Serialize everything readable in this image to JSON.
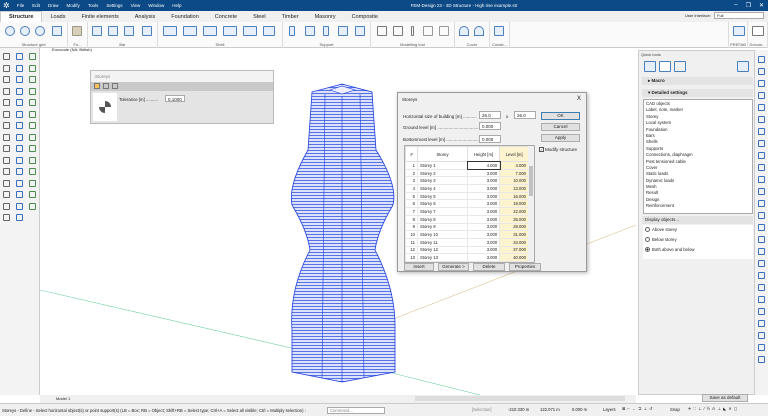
{
  "titlebar": {
    "title": "FEM-Design 23 - 3D Structure - High rise example.str",
    "menu": [
      "File",
      "Edit",
      "Draw",
      "Modify",
      "Tools",
      "Settings",
      "View",
      "Window",
      "Help"
    ]
  },
  "tabs": [
    "Structure",
    "Loads",
    "Finite elements",
    "Analysis",
    "Foundation",
    "Concrete",
    "Steel",
    "Timber",
    "Masonry",
    "Composite"
  ],
  "user_interface": {
    "label": "User interface:",
    "value": "Full"
  },
  "ribbon_groups": [
    "Structure grid",
    "Fo...",
    "Bar",
    "Shell",
    "Support",
    "Modelling tool",
    "Cover",
    "Constr...",
    "PREFAB",
    "Docum..."
  ],
  "canvas": {
    "code": "Eurocode (NA: British)",
    "model_tab": "Model 1"
  },
  "mini_panel": {
    "title": "Storeys",
    "tolerance_label": "Tolerance [m] ..........",
    "tolerance_value": "0.1000"
  },
  "dialog": {
    "title": "Storeys",
    "close": "X",
    "hsize_label": "Horizontal size of building [m] ...........",
    "hsize_x": "26.0",
    "x": "x",
    "hsize_y": "26.0",
    "ground_label": "Ground level [m] ....................................",
    "ground_value": "0.000",
    "bottom_label": "Bottommost level [m] ............................",
    "bottom_value": "0.000",
    "ok": "OK",
    "cancel": "Cancel",
    "apply": "Apply",
    "modify": "Modify structure",
    "columns": {
      "num": "#",
      "storey": "Storey",
      "height": "Height [m]",
      "level": "Level [m]"
    },
    "rows": [
      {
        "n": "1",
        "name": "Storey 1",
        "h": "4.000",
        "l": "4.000"
      },
      {
        "n": "2",
        "name": "Storey 2",
        "h": "3.000",
        "l": "7.000"
      },
      {
        "n": "3",
        "name": "Storey 3",
        "h": "3.000",
        "l": "10.000"
      },
      {
        "n": "4",
        "name": "Storey 4",
        "h": "3.000",
        "l": "13.000"
      },
      {
        "n": "5",
        "name": "Storey 5",
        "h": "3.000",
        "l": "16.000"
      },
      {
        "n": "6",
        "name": "Storey 6",
        "h": "3.000",
        "l": "19.000"
      },
      {
        "n": "7",
        "name": "Storey 7",
        "h": "3.000",
        "l": "22.000"
      },
      {
        "n": "8",
        "name": "Storey 8",
        "h": "3.000",
        "l": "25.000"
      },
      {
        "n": "9",
        "name": "Storey 9",
        "h": "3.000",
        "l": "28.000"
      },
      {
        "n": "10",
        "name": "Storey 10",
        "h": "3.000",
        "l": "31.000"
      },
      {
        "n": "11",
        "name": "Storey 11",
        "h": "3.000",
        "l": "34.000"
      },
      {
        "n": "12",
        "name": "Storey 12",
        "h": "3.000",
        "l": "37.000"
      },
      {
        "n": "13",
        "name": "Storey 13",
        "h": "3.000",
        "l": "40.000"
      }
    ],
    "insert": "Insert",
    "generate": "Generate >",
    "delete": "Delete",
    "properties": "Properties"
  },
  "quick_tools": {
    "title": "Quick tools",
    "macro": "Macro",
    "detailed": "Detailed settings",
    "items": [
      "CAD objects",
      "Label, note, marker",
      "Storey",
      "Local system",
      "Foundation",
      "Bars",
      "Shells",
      "Supports",
      "Connections, diaphragm",
      "Post tensioned cable",
      "Cover",
      "Static loads",
      "Dynamic loads",
      "Mesh",
      "Result",
      "Design",
      "Reinforcement"
    ],
    "display_label": "Display objects...",
    "radios": [
      "Above storey",
      "Below storey",
      "Both above and below"
    ],
    "selected_radio": 2,
    "save_default": "Save as default"
  },
  "status": {
    "prompt": "Storeys - Define - Select horizontal object(s) or point support(s) (LB = Box; RB = Object; Shift+RB = Select type; Ctrl+A = Select all visible; Ctrl = Multiply selection) :",
    "command_placeholder": "Command...",
    "selection": "[Selection]",
    "x": "-210.330 m",
    "y": "122.071 m",
    "z": "0.000 m",
    "layers": "Layers",
    "snap": "Snap"
  },
  "colors": {
    "titlebar": "#0b4a86",
    "structure": "#1f3fe0",
    "level_cell": "#fdf3cf"
  }
}
